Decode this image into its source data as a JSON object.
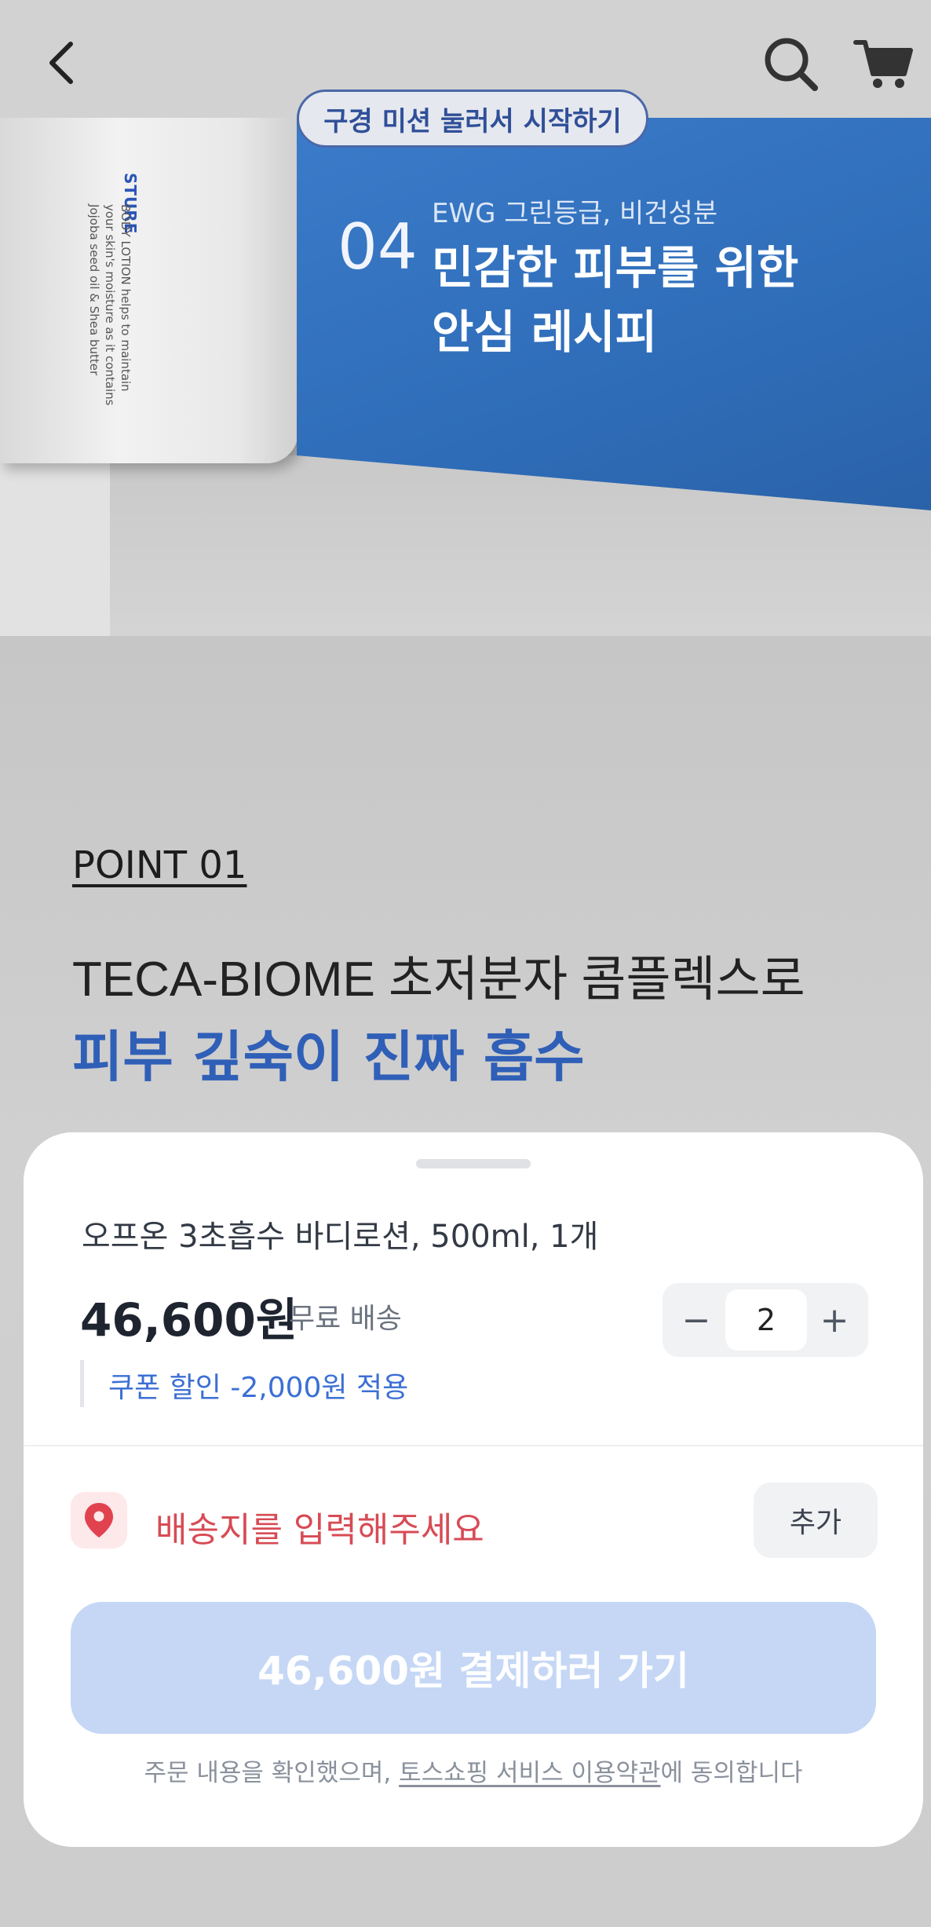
{
  "header": {
    "back_icon": "chevron-left-icon",
    "search_icon": "search-icon",
    "cart_icon": "cart-icon"
  },
  "mission": {
    "label": "구경 미션 눌러서 시작하기"
  },
  "hero": {
    "bottle_brand": "STURE",
    "bottle_text_line1": "BODY LOTION helps to maintain",
    "bottle_text_line2": "your skin's moisture as it contains",
    "bottle_text_line3": "Jojoba seed oil & Shea butter",
    "panel_number": "04",
    "panel_sub": "EWG 그린등급, 비건성분",
    "panel_title_1": "민감한 피부를 위한",
    "panel_title_2": "안심 레시피"
  },
  "content": {
    "point_label": "POINT 01",
    "headline_1": "TECA-BIOME 초저분자 콤플렉스로",
    "headline_2": "피부 깊숙이 진짜 흡수"
  },
  "sheet": {
    "product_name": "오프온 3초흡수 바디로션, 500ml, 1개",
    "price": "46,600원",
    "shipping": "무료 배송",
    "coupon": "쿠폰 할인 -2,000원 적용",
    "quantity": "2",
    "minus_label": "−",
    "plus_label": "+",
    "address_prompt": "배송지를 입력해주세요",
    "add_label": "추가",
    "pay_label": "46,600원 결제하러 가기",
    "terms_prefix": "주문 내용을 확인했으며, ",
    "terms_link": "토스쇼핑 서비스 이용약관",
    "terms_suffix": "에 동의합니다"
  },
  "colors": {
    "accent_blue": "#3c6fd4",
    "pay_button": "#c5d7f5",
    "address_red": "#d74b55",
    "panel_blue": "#2f6db9"
  }
}
